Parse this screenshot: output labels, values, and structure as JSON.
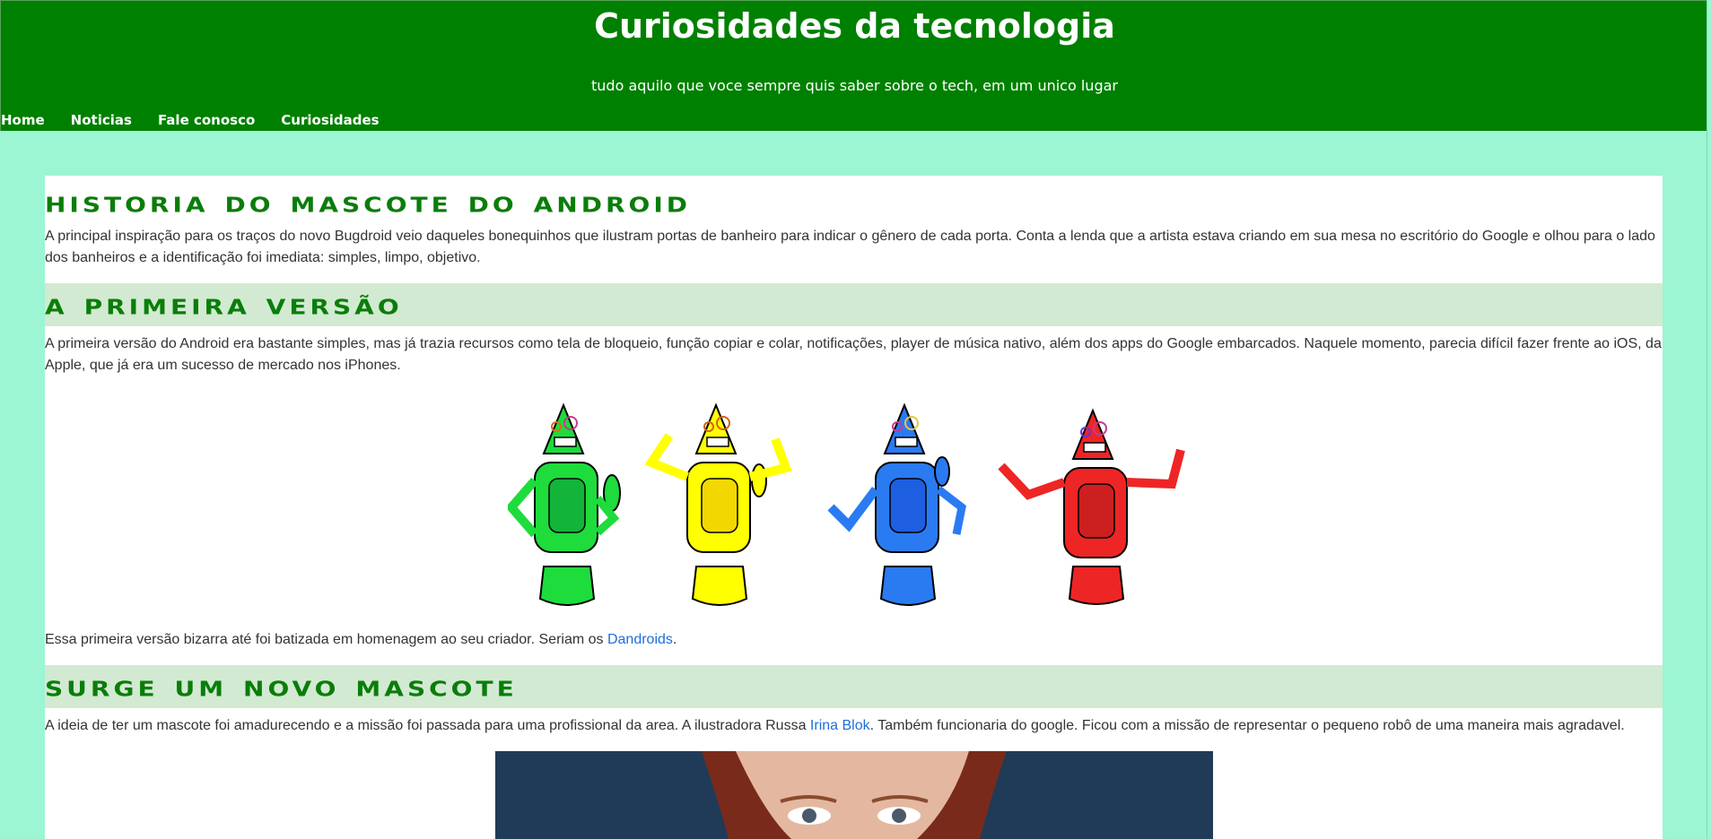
{
  "header": {
    "title": "Curiosidades da tecnologia",
    "subtitle": "tudo aquilo que voce sempre quis saber sobre o tech, em um unico lugar"
  },
  "nav": {
    "items": [
      {
        "label": "Home"
      },
      {
        "label": "Noticias"
      },
      {
        "label": "Fale conosco"
      },
      {
        "label": "Curiosidades"
      }
    ]
  },
  "colors": {
    "header_bg": "#008000",
    "page_bg": "#9cf5d3",
    "heading": "#0a7d0a",
    "band": "#d2ead2",
    "link": "#1e6fd9"
  },
  "sections": [
    {
      "heading": "Historia do mascote do android",
      "text": "A principal inspiração para os traços do novo Bugdroid veio daqueles bonequinhos que ilustram portas de banheiro para indicar o gênero de cada porta. Conta a lenda que a artista estava criando em sua mesa no escritório do Google e olhou para o lado dos banheiros e a identificação foi imediata: simples, limpo, objetivo."
    },
    {
      "heading": "A primeira versão",
      "text": "A primeira versão do Android era bastante simples, mas já trazia recursos como tela de bloqueio, função copiar e colar, notificações, player de música nativo, além dos apps do Google embarcados. Naquele momento, parecia difícil fazer frente ao iOS, da Apple, que já era um sucesso de mercado nos iPhones.",
      "after_image_text": "Essa primeira versão bizarra até foi batizada em homenagem ao seu criador. Seriam os ",
      "after_image_link": "Dandroids",
      "after_image_end": "."
    },
    {
      "heading": "Surge um novo mascote",
      "text_before": "A ideia de ter um mascote foi amadurecendo e a missão foi passada para uma profissional da area. A ilustradora Russa ",
      "link": "Irina Blok",
      "text_after": ". Também funcionaria do google. Ficou com a missão de representar o pequeno robô de uma maneira mais agradavel."
    }
  ],
  "images": {
    "dandroids": "dandroids-illustration",
    "portrait": "irina-blok-portrait"
  }
}
